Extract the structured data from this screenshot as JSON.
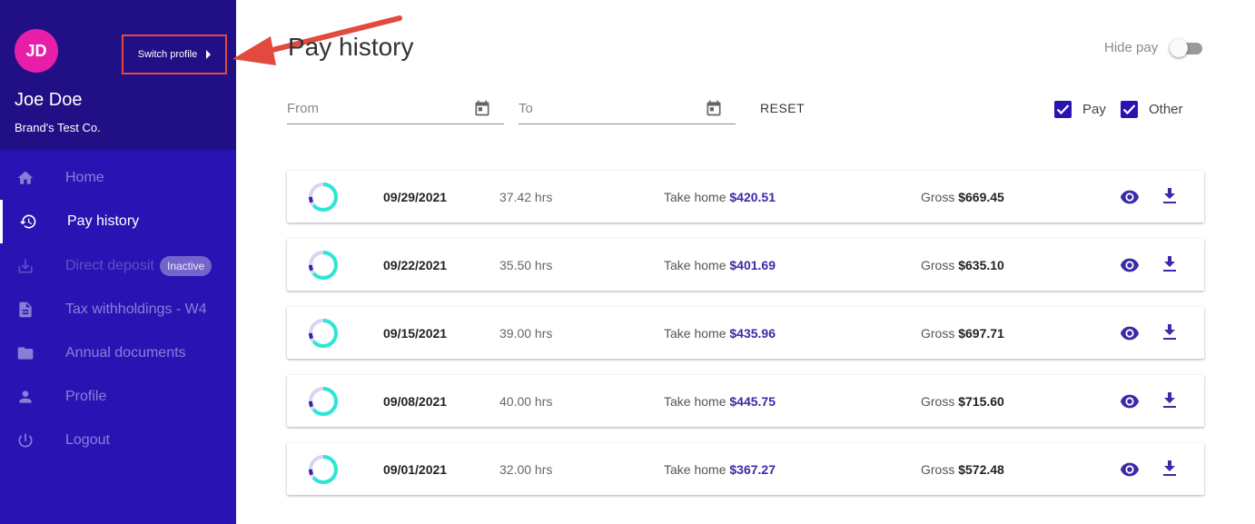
{
  "colors": {
    "sidebar": "#2a13b3",
    "sidebar_header": "#210f86",
    "avatar": "#e91ea8",
    "accent": "#3a2aa8",
    "ring": "#2ee6d6",
    "annotation": "#e24a3f"
  },
  "profile": {
    "initials": "JD",
    "name": "Joe Doe",
    "company": "Brand's Test Co.",
    "switch_label": "Switch profile"
  },
  "nav": [
    {
      "label": "Home",
      "icon": "home-icon"
    },
    {
      "label": "Pay history",
      "icon": "history-icon",
      "active": true
    },
    {
      "label": "Direct deposit",
      "icon": "download-tray-icon",
      "badge": "Inactive"
    },
    {
      "label": "Tax withholdings - W4",
      "icon": "document-icon"
    },
    {
      "label": "Annual documents",
      "icon": "folder-icon"
    },
    {
      "label": "Profile",
      "icon": "person-icon"
    },
    {
      "label": "Logout",
      "icon": "power-icon"
    }
  ],
  "header": {
    "title": "Pay history",
    "hide_pay_label": "Hide pay",
    "hide_pay_on": false
  },
  "filters": {
    "from_placeholder": "From",
    "to_placeholder": "To",
    "reset_label": "RESET",
    "pay_label": "Pay",
    "pay_checked": true,
    "other_label": "Other",
    "other_checked": true
  },
  "pay_rows": [
    {
      "date": "09/29/2021",
      "hours": "37.42 hrs",
      "take_home_label": "Take home",
      "take_home": "$420.51",
      "gross_label": "Gross",
      "gross": "$669.45"
    },
    {
      "date": "09/22/2021",
      "hours": "35.50 hrs",
      "take_home_label": "Take home",
      "take_home": "$401.69",
      "gross_label": "Gross",
      "gross": "$635.10"
    },
    {
      "date": "09/15/2021",
      "hours": "39.00 hrs",
      "take_home_label": "Take home",
      "take_home": "$435.96",
      "gross_label": "Gross",
      "gross": "$697.71"
    },
    {
      "date": "09/08/2021",
      "hours": "40.00 hrs",
      "take_home_label": "Take home",
      "take_home": "$445.75",
      "gross_label": "Gross",
      "gross": "$715.60"
    },
    {
      "date": "09/01/2021",
      "hours": "32.00 hrs",
      "take_home_label": "Take home",
      "take_home": "$367.27",
      "gross_label": "Gross",
      "gross": "$572.48"
    }
  ]
}
